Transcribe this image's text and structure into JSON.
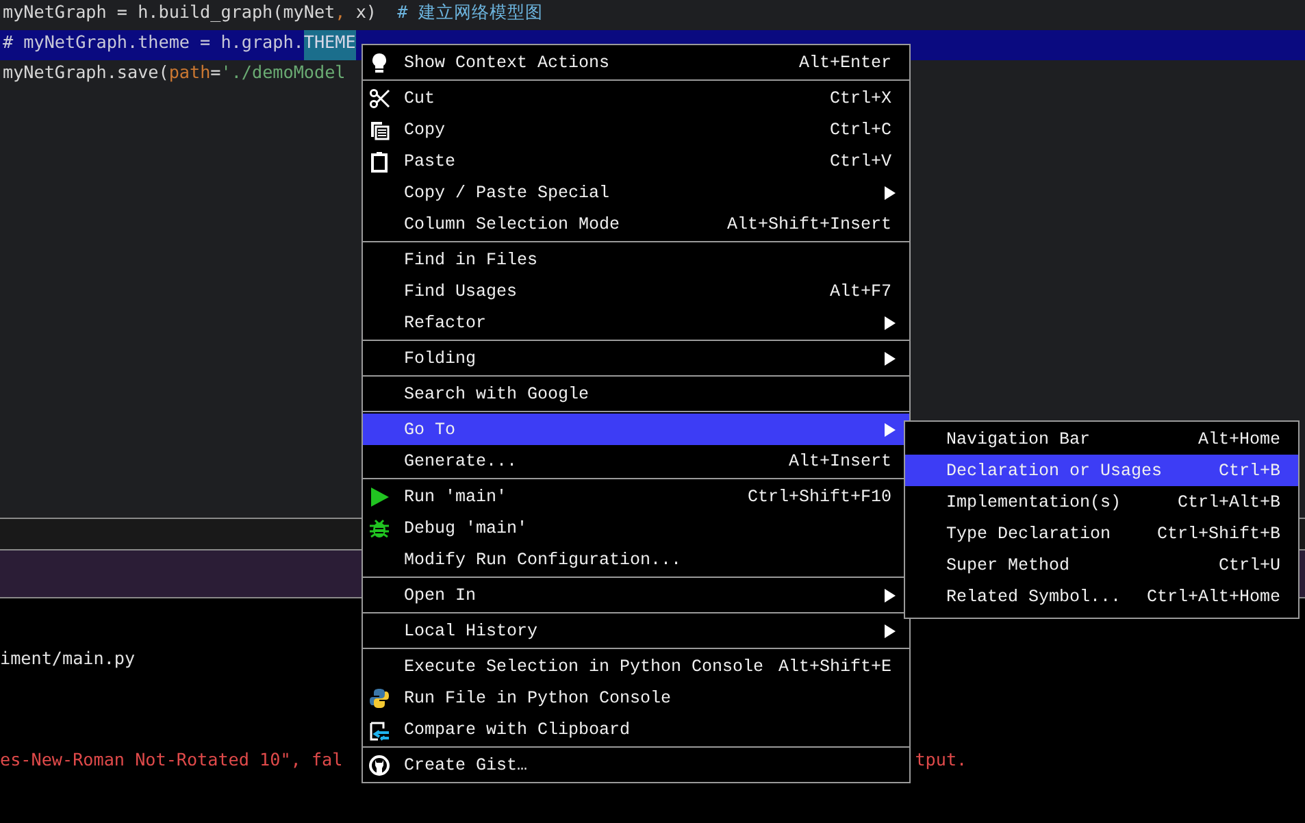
{
  "editor": {
    "lines": [
      [
        {
          "kind": "plain",
          "text": "myNetGraph = h.build_graph(myNet"
        },
        {
          "kind": "param",
          "text": ","
        },
        {
          "kind": "plain",
          "text": " x)  "
        },
        {
          "kind": "comment",
          "text": "# 建立网络模型图"
        }
      ],
      [
        {
          "kind": "selected",
          "text": "# myNetGraph.theme = h.graph."
        },
        {
          "kind": "match",
          "text": "THEME"
        }
      ],
      [
        {
          "kind": "plain",
          "text": "myNetGraph.save("
        },
        {
          "kind": "param",
          "text": "path"
        },
        {
          "kind": "plain",
          "text": "="
        },
        {
          "kind": "string",
          "text": "'./demoModel"
        }
      ]
    ]
  },
  "console": {
    "path": "iment/main.py",
    "error_left": "es-New-Roman Not-Rotated 10\", fal",
    "error_right": "tput."
  },
  "context_menu": {
    "groups": [
      [
        {
          "label": "Show Context Actions",
          "shortcut": "Alt+Enter",
          "submenu": false,
          "selected": false
        }
      ],
      [
        {
          "label": "Cut",
          "shortcut": "Ctrl+X",
          "submenu": false,
          "selected": false
        },
        {
          "label": "Copy",
          "shortcut": "Ctrl+C",
          "submenu": false,
          "selected": false
        },
        {
          "label": "Paste",
          "shortcut": "Ctrl+V",
          "submenu": false,
          "selected": false
        },
        {
          "label": "Copy / Paste Special",
          "submenu": true,
          "selected": false
        },
        {
          "label": "Column Selection Mode",
          "shortcut": "Alt+Shift+Insert",
          "submenu": false,
          "selected": false
        }
      ],
      [
        {
          "label": "Find in Files",
          "submenu": false,
          "selected": false
        },
        {
          "label": "Find Usages",
          "shortcut": "Alt+F7",
          "submenu": false,
          "selected": false
        },
        {
          "label": "Refactor",
          "submenu": true,
          "selected": false
        }
      ],
      [
        {
          "label": "Folding",
          "submenu": true,
          "selected": false
        }
      ],
      [
        {
          "label": "Search with Google",
          "submenu": false,
          "selected": false
        }
      ],
      [
        {
          "label": "Go To",
          "submenu": true,
          "selected": true
        },
        {
          "label": "Generate...",
          "shortcut": "Alt+Insert",
          "submenu": false,
          "selected": false
        }
      ],
      [
        {
          "label": "Run 'main'",
          "shortcut": "Ctrl+Shift+F10",
          "submenu": false,
          "selected": false
        },
        {
          "label": "Debug 'main'",
          "submenu": false,
          "selected": false
        },
        {
          "label": "Modify Run Configuration...",
          "submenu": false,
          "selected": false
        }
      ],
      [
        {
          "label": "Open In",
          "submenu": true,
          "selected": false
        }
      ],
      [
        {
          "label": "Local History",
          "submenu": true,
          "selected": false
        }
      ],
      [
        {
          "label": "Execute Selection in Python Console",
          "shortcut": "Alt+Shift+E",
          "submenu": false,
          "selected": false
        },
        {
          "label": "Run File in Python Console",
          "submenu": false,
          "selected": false
        },
        {
          "label": "Compare with Clipboard",
          "submenu": false,
          "selected": false
        }
      ],
      [
        {
          "label": "Create Gist…",
          "submenu": false,
          "selected": false
        }
      ]
    ]
  },
  "submenu": {
    "items": [
      {
        "label": "Navigation Bar",
        "shortcut": "Alt+Home",
        "selected": false
      },
      {
        "label": "Declaration or Usages",
        "shortcut": "Ctrl+B",
        "selected": true
      },
      {
        "label": "Implementation(s)",
        "shortcut": "Ctrl+Alt+B",
        "selected": false
      },
      {
        "label": "Type Declaration",
        "shortcut": "Ctrl+Shift+B",
        "selected": false
      },
      {
        "label": "Super Method",
        "shortcut": "Ctrl+U",
        "selected": false
      },
      {
        "label": "Related Symbol...",
        "shortcut": "Ctrl+Alt+Home",
        "selected": false
      }
    ]
  }
}
